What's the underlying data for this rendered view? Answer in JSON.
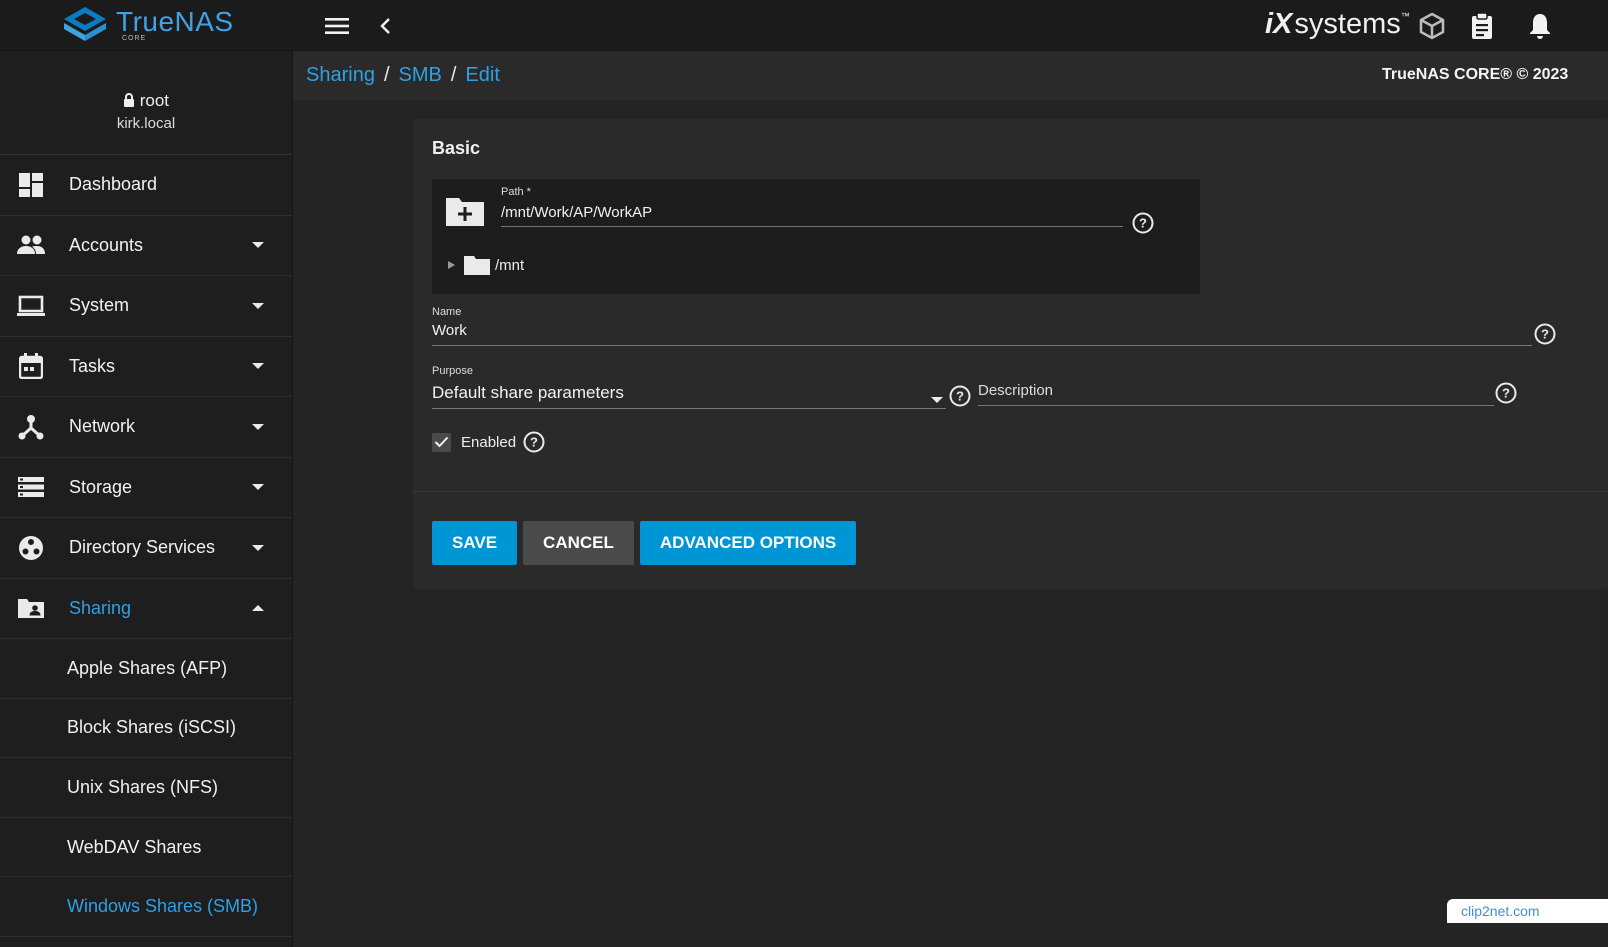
{
  "topbar": {
    "brand": "TrueNAS",
    "brand_sub": "CORE",
    "ix_mark": "iX",
    "ix_text": "systems",
    "ix_tm": "™"
  },
  "user": {
    "name": "root",
    "host": "kirk.local"
  },
  "nav": [
    {
      "label": "Dashboard",
      "icon": "dashboard-icon",
      "caret": ""
    },
    {
      "label": "Accounts",
      "icon": "people-icon",
      "caret": "down"
    },
    {
      "label": "System",
      "icon": "laptop-icon",
      "caret": "down"
    },
    {
      "label": "Tasks",
      "icon": "calendar-icon",
      "caret": "down"
    },
    {
      "label": "Network",
      "icon": "network-icon",
      "caret": "down"
    },
    {
      "label": "Storage",
      "icon": "storage-icon",
      "caret": "down"
    },
    {
      "label": "Directory Services",
      "icon": "directory-icon",
      "caret": "down"
    },
    {
      "label": "Sharing",
      "icon": "folder-shared-icon",
      "caret": "up"
    }
  ],
  "sharing_sub": [
    {
      "label": "Apple Shares (AFP)"
    },
    {
      "label": "Block Shares (iSCSI)"
    },
    {
      "label": "Unix Shares (NFS)"
    },
    {
      "label": "WebDAV Shares"
    },
    {
      "label": "Windows Shares (SMB)"
    }
  ],
  "breadcrumbs": [
    "Sharing",
    "SMB",
    "Edit"
  ],
  "copyright": "TrueNAS CORE® © 2023",
  "form": {
    "section_title": "Basic",
    "path_label": "Path *",
    "path_value": "/mnt/Work/AP/WorkAP",
    "tree_root": "/mnt",
    "name_label": "Name",
    "name_value": "Work",
    "purpose_label": "Purpose",
    "purpose_value": "Default share parameters",
    "description_placeholder": "Description",
    "enabled_label": "Enabled",
    "enabled": true
  },
  "buttons": {
    "save": "SAVE",
    "cancel": "CANCEL",
    "advanced": "ADVANCED OPTIONS"
  },
  "watermark": "clip2net.com",
  "colors": {
    "accent": "#0095d5",
    "link": "#2fa0e4",
    "background": "#242424"
  }
}
